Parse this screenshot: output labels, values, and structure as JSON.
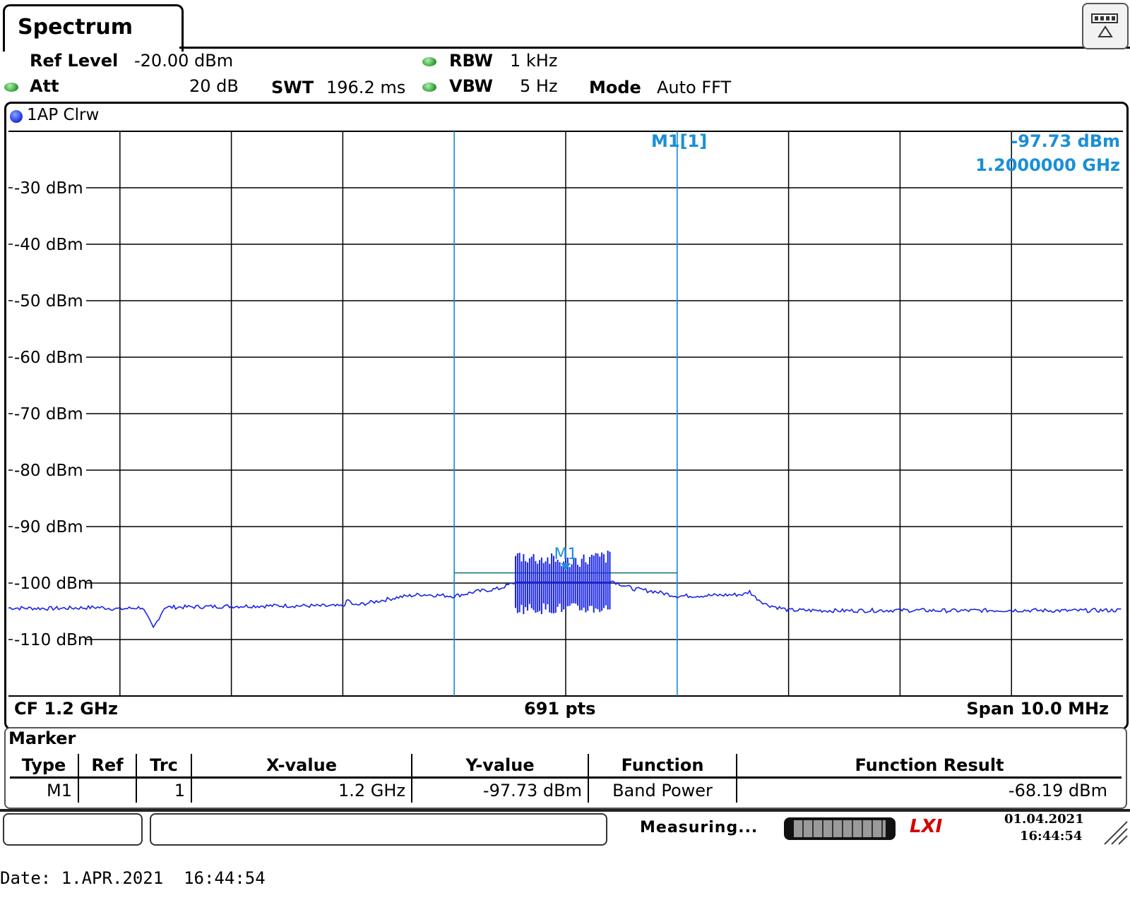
{
  "tab": {
    "title": "Spectrum"
  },
  "settings": {
    "ref_level_label": "Ref Level",
    "ref_level_value": "-20.00 dBm",
    "att_label": "Att",
    "att_value": "20 dB",
    "swt_label": "SWT",
    "swt_value": "196.2 ms",
    "rbw_label": "RBW",
    "rbw_value": "1 kHz",
    "vbw_label": "VBW",
    "vbw_value": "5 Hz",
    "mode_label": "Mode",
    "mode_value": "Auto FFT"
  },
  "trace": {
    "label": "1AP Clrw"
  },
  "marker_readout": {
    "name": "M1[1]",
    "level": "-97.73 dBm",
    "frequency": "1.2000000 GHz",
    "plot_label": "M1"
  },
  "footer": {
    "cf": "CF 1.2 GHz",
    "pts": "691 pts",
    "span": "Span 10.0 MHz"
  },
  "chart_data": {
    "type": "line",
    "y_ticks": [
      "-30 dBm",
      "-40 dBm",
      "-50 dBm",
      "-60 dBm",
      "-70 dBm",
      "-80 dBm",
      "-90 dBm",
      "-100 dBm",
      "-110 dBm"
    ],
    "y_tick_values": [
      -30,
      -40,
      -50,
      -60,
      -70,
      -80,
      -90,
      -100,
      -110
    ],
    "ylim": [
      -120,
      -20
    ],
    "xlim_mhz": [
      -5,
      5
    ],
    "grid": true,
    "band_power_marker_x_mhz": [
      -1,
      1
    ],
    "band_power_level_dbm": -98.2,
    "series": [
      {
        "color": "#1a24e6",
        "points_mhz_dbm": [
          [
            -5.0,
            -104.4
          ],
          [
            -4.6,
            -104.5
          ],
          [
            -4.2,
            -104.3
          ],
          [
            -4.0,
            -104.6
          ],
          [
            -3.8,
            -104.3
          ],
          [
            -3.7,
            -108.0
          ],
          [
            -3.6,
            -104.3
          ],
          [
            -3.0,
            -104.1
          ],
          [
            -2.5,
            -104.0
          ],
          [
            -2.0,
            -104.1
          ],
          [
            -1.95,
            -103.0
          ],
          [
            -1.9,
            -104.0
          ],
          [
            -1.5,
            -102.5
          ],
          [
            -1.3,
            -102.0
          ],
          [
            -1.0,
            -102.3
          ],
          [
            -0.8,
            -101.5
          ],
          [
            -0.6,
            -101.0
          ],
          [
            -0.4,
            -99.5
          ],
          [
            -0.2,
            -98.5
          ],
          [
            0.0,
            -97.7
          ],
          [
            0.2,
            -98.5
          ],
          [
            0.4,
            -99.5
          ],
          [
            0.6,
            -101.0
          ],
          [
            0.8,
            -101.5
          ],
          [
            1.0,
            -102.3
          ],
          [
            1.3,
            -102.2
          ],
          [
            1.6,
            -102.0
          ],
          [
            1.65,
            -101.5
          ],
          [
            1.7,
            -102.5
          ],
          [
            1.8,
            -103.8
          ],
          [
            2.0,
            -104.8
          ],
          [
            2.5,
            -104.9
          ],
          [
            3.0,
            -104.8
          ],
          [
            3.5,
            -104.9
          ],
          [
            4.0,
            -104.8
          ],
          [
            4.5,
            -104.9
          ],
          [
            5.0,
            -104.8
          ]
        ],
        "burst_region_mhz": [
          -0.45,
          0.4
        ],
        "burst_min_dbm": -105.5,
        "burst_max_dbm": -97.5
      }
    ]
  },
  "marker_table": {
    "title": "Marker",
    "headers": [
      "Type",
      "Ref",
      "Trc",
      "X-value",
      "Y-value",
      "Function",
      "Function Result"
    ],
    "row": {
      "type": "M1",
      "ref": "",
      "trc": "1",
      "x": "1.2 GHz",
      "y": "-97.73 dBm",
      "function": "Band Power",
      "result": "-68.19 dBm"
    }
  },
  "status": {
    "text": "Measuring...",
    "date": "01.04.2021",
    "time": "16:44:54",
    "lxi": "LXI"
  },
  "datestamp": "Date: 1.APR.2021  16:44:54",
  "colors": {
    "trace": "#1a24e6",
    "marker": "#1a8fd8",
    "band_line": "#1a7a6a",
    "status_dot": "#2e9b2e"
  }
}
